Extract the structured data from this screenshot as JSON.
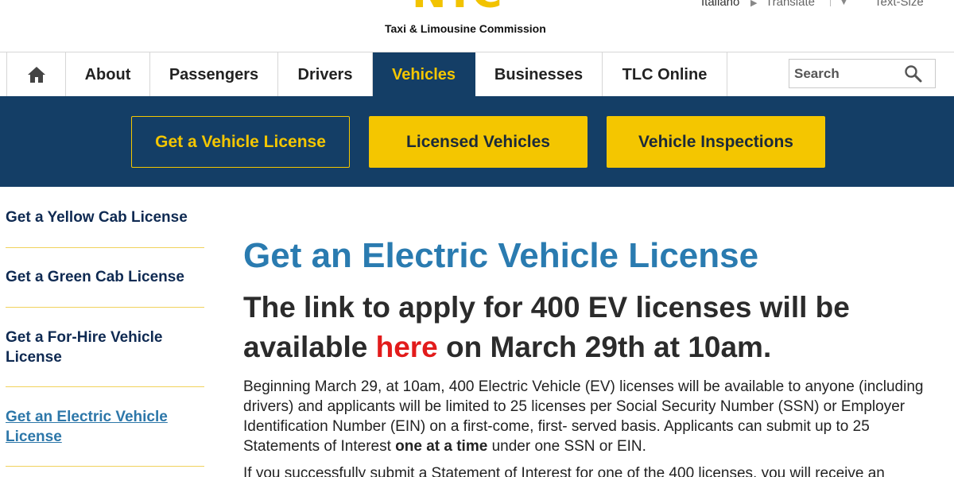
{
  "header": {
    "logo_text": "NYC",
    "logo_subtitle": "Taxi & Limousine Commission",
    "language": "Italiano",
    "translate": "Translate",
    "text_size": "Text-Size"
  },
  "nav": {
    "items": [
      {
        "label": "About"
      },
      {
        "label": "Passengers"
      },
      {
        "label": "Drivers"
      },
      {
        "label": "Vehicles"
      },
      {
        "label": "Businesses"
      },
      {
        "label": "TLC Online"
      }
    ],
    "search_placeholder": "Search"
  },
  "subnav": {
    "buttons": [
      {
        "label": "Get a Vehicle License"
      },
      {
        "label": "Licensed Vehicles"
      },
      {
        "label": "Vehicle Inspections"
      }
    ]
  },
  "sidebar": {
    "items": [
      {
        "label": "Get a Yellow Cab License"
      },
      {
        "label": "Get a Green Cab License"
      },
      {
        "label": "Get a For-Hire Vehicle License"
      },
      {
        "label": "Get an Electric Vehicle License"
      }
    ]
  },
  "main": {
    "title": "Get an Electric Vehicle License",
    "subtitle_before": "The link to apply for 400 EV licenses will be available ",
    "subtitle_link": "here",
    "subtitle_after": " on March 29th at 10am.",
    "para1_before": "Beginning March 29, at 10am, 400 Electric Vehicle (EV) licenses will be available to anyone (including drivers) and applicants will be limited to 25 licenses per Social Security Number (SSN) or Employer Identification Number (EIN) on a first-come, first- served basis. Applicants can submit up to 25 Statements of Interest ",
    "para1_bold": "one at a time",
    "para1_after": " under one SSN or EIN.",
    "para2": "If you successfully submit a Statement of Interest for one of the 400 licenses, you will receive an"
  },
  "colors": {
    "navy": "#143e66",
    "yellow": "#f4c600",
    "title_blue": "#2a7bb0",
    "link_red": "#e21b1b"
  }
}
